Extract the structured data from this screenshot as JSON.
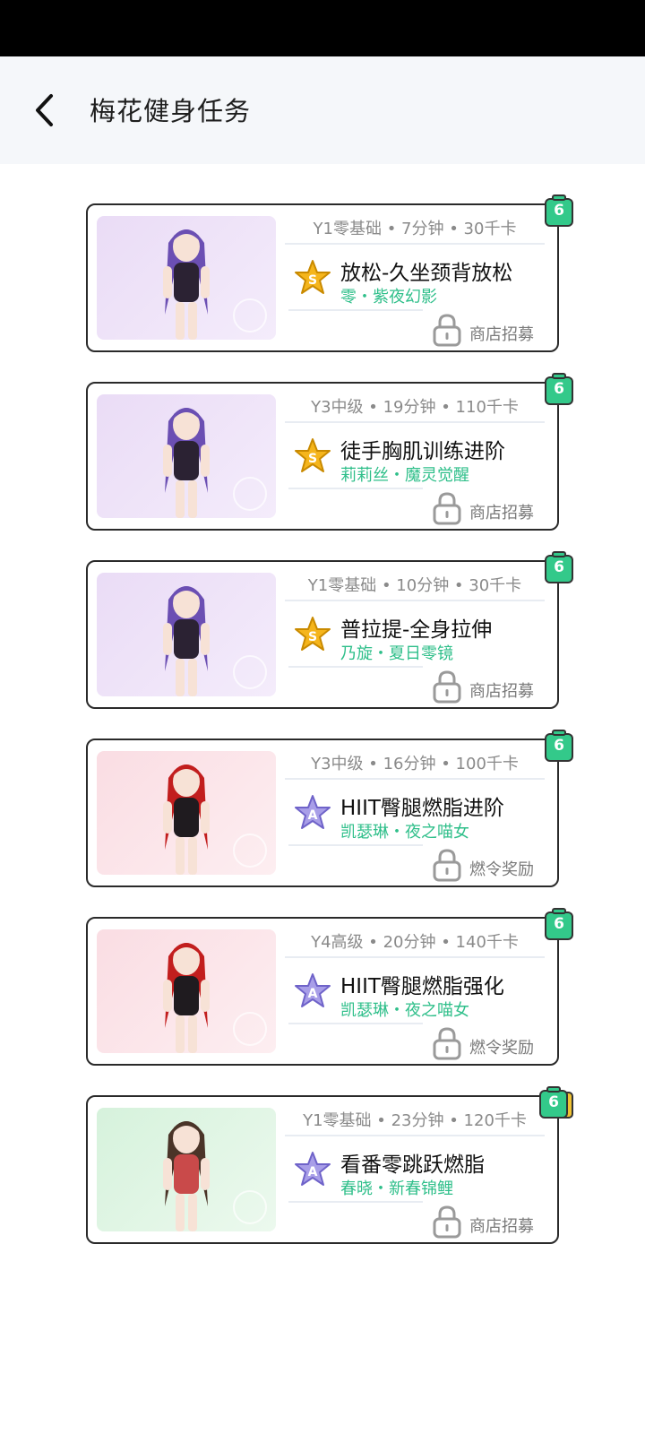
{
  "header": {
    "title": "梅花健身任务",
    "back_icon": "chevron-left-icon"
  },
  "colors": {
    "name_green": "#2fbf8a",
    "badge_green": "#33c98a",
    "grade_s": "#f5b51c",
    "grade_a": "#a89ee8"
  },
  "cards": [
    {
      "meta": "Y1零基础 • 7分钟 • 30千卡",
      "grade": "S",
      "title": "放松-久坐颈背放松",
      "character": "零・紫夜幻影",
      "source": "商店招募",
      "count": "6",
      "theme": "purple"
    },
    {
      "meta": "Y3中级 • 19分钟 • 110千卡",
      "grade": "S",
      "title": "徒手胸肌训练进阶",
      "character": "莉莉丝・魔灵觉醒",
      "source": "商店招募",
      "count": "6",
      "theme": "purple"
    },
    {
      "meta": "Y1零基础 • 10分钟 • 30千卡",
      "grade": "S",
      "title": "普拉提-全身拉伸",
      "character": "乃旋・夏日零镜",
      "source": "商店招募",
      "count": "6",
      "theme": "purple"
    },
    {
      "meta": "Y3中级 • 16分钟 • 100千卡",
      "grade": "A",
      "title": "HIIT臀腿燃脂进阶",
      "character": "凯瑟琳・夜之喵女",
      "source": "燃令奖励",
      "count": "6",
      "theme": "pink"
    },
    {
      "meta": "Y4高级 • 20分钟 • 140千卡",
      "grade": "A",
      "title": "HIIT臀腿燃脂强化",
      "character": "凯瑟琳・夜之喵女",
      "source": "燃令奖励",
      "count": "6",
      "theme": "pink"
    },
    {
      "meta": "Y1零基础 • 23分钟 • 120千卡",
      "grade": "A",
      "title": "看番零跳跃燃脂",
      "character": "春晓・新春锦鲤",
      "source": "商店招募",
      "count": "6",
      "theme": "green"
    }
  ]
}
